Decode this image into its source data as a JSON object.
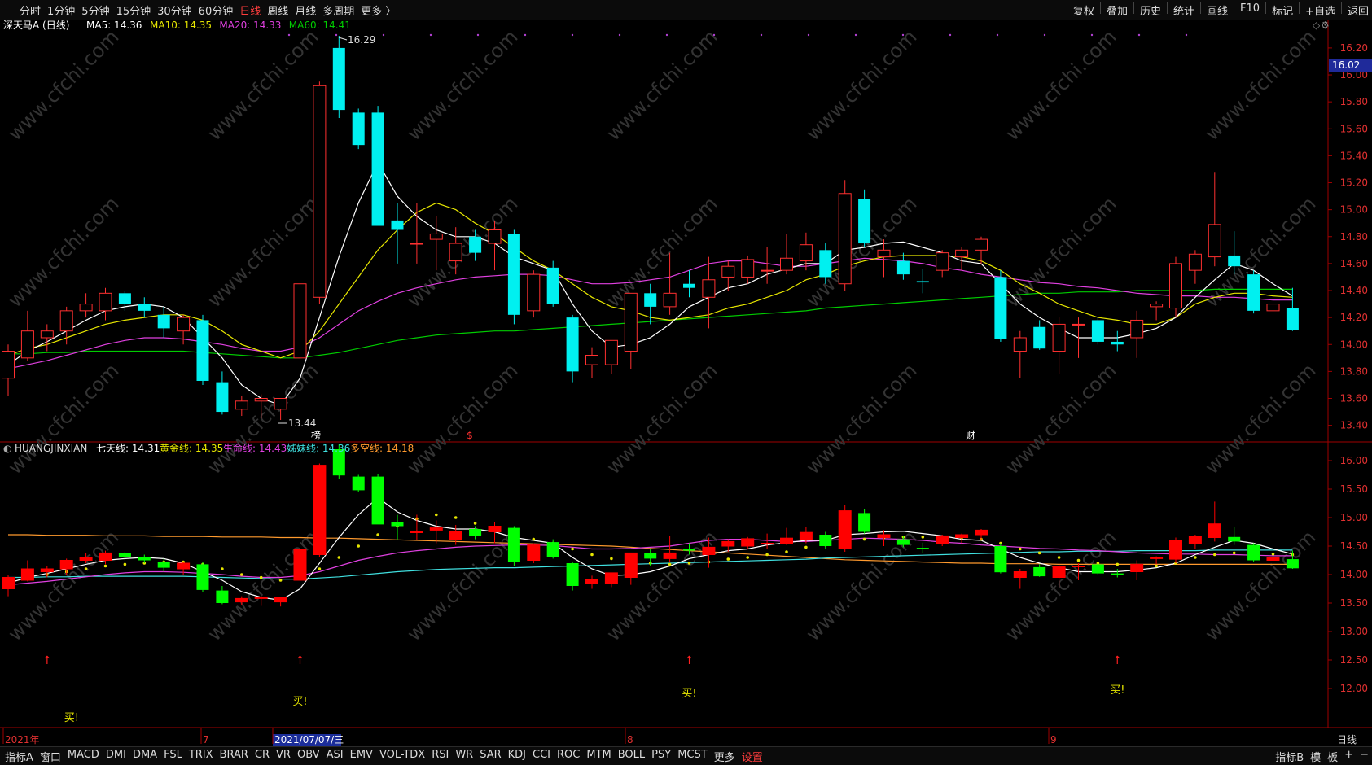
{
  "toolbar": {
    "periods": [
      "分时",
      "1分钟",
      "5分钟",
      "15分钟",
      "30分钟",
      "60分钟",
      "日线",
      "周线",
      "月线",
      "多周期",
      "更多 〉"
    ],
    "active_period": "日线",
    "right": [
      "复权",
      "叠加",
      "历史",
      "统计",
      "画线",
      "F10",
      "标记",
      "+自选",
      "返回"
    ]
  },
  "main_chart": {
    "stock_title": "深天马A (日线)",
    "legend": [
      {
        "label": "MA5: 14.36",
        "color": "#ffffff"
      },
      {
        "label": "MA10: 14.35",
        "color": "#e6e600"
      },
      {
        "label": "MA20: 14.33",
        "color": "#e040e0"
      },
      {
        "label": "MA60: 14.41",
        "color": "#00cc00"
      }
    ],
    "high_label": "16.29",
    "low_label": "13.44",
    "current_price_tag": "16.02",
    "y_axis_ticks": [
      "16.20",
      "16.00",
      "15.80",
      "15.60",
      "15.40",
      "15.20",
      "15.00",
      "14.80",
      "14.60",
      "14.40",
      "14.20",
      "14.00",
      "13.80",
      "13.60",
      "13.40"
    ],
    "markers": [
      {
        "text": "榜",
        "color": "#ffffff"
      },
      {
        "text": "$",
        "color": "#ff3030"
      },
      {
        "text": "财",
        "color": "#ffffff"
      }
    ]
  },
  "sub_chart": {
    "indicator_name": "HUANGJINXIAN",
    "legend": [
      {
        "label": "七天线: 14.31",
        "color": "#ffffff"
      },
      {
        "label": "黄金线: 14.35",
        "color": "#e6e600"
      },
      {
        "label": "生命线: 14.43",
        "color": "#e040e0"
      },
      {
        "label": "姊妹线: 14.36",
        "color": "#40e0e0"
      },
      {
        "label": "多空线: 14.18",
        "color": "#ff9a2e"
      }
    ],
    "y_axis_ticks": [
      "16.00",
      "15.50",
      "15.00",
      "14.50",
      "14.00",
      "13.50",
      "13.00",
      "12.50",
      "12.00"
    ],
    "buy_labels": [
      "买!",
      "买!",
      "买!",
      "买!"
    ]
  },
  "x_axis": {
    "labels": [
      "2021年",
      "7",
      "2021/07/07/三",
      "8",
      "9"
    ],
    "side_label": "日线"
  },
  "watermark": "www.cfchi.com",
  "bottom_tabs": [
    "指标A",
    "窗口",
    "MACD",
    "DMI",
    "DMA",
    "FSL",
    "TRIX",
    "BRAR",
    "CR",
    "VR",
    "OBV",
    "ASI",
    "EMV",
    "VOL-TDX",
    "RSI",
    "WR",
    "SAR",
    "KDJ",
    "CCI",
    "ROC",
    "MTM",
    "BOLL",
    "PSY",
    "MCST",
    "更多",
    "设置"
  ],
  "bottom_right": [
    "指标B",
    "模",
    "板",
    "+",
    "−"
  ],
  "colors": {
    "up": "#ff3030",
    "down": "#00f0f0",
    "sub_up": "#ff0000",
    "sub_down": "#00ff00",
    "grid": "#5a0000"
  },
  "chart_data": {
    "type": "candlestick",
    "candles": [
      {
        "o": 13.75,
        "h": 14.0,
        "l": 13.62,
        "c": 13.95
      },
      {
        "o": 13.9,
        "h": 14.25,
        "l": 13.88,
        "c": 14.1
      },
      {
        "o": 14.05,
        "h": 14.15,
        "l": 13.95,
        "c": 14.1
      },
      {
        "o": 14.1,
        "h": 14.28,
        "l": 14.0,
        "c": 14.25
      },
      {
        "o": 14.25,
        "h": 14.38,
        "l": 14.2,
        "c": 14.3
      },
      {
        "o": 14.25,
        "h": 14.42,
        "l": 14.18,
        "c": 14.38
      },
      {
        "o": 14.38,
        "h": 14.4,
        "l": 14.25,
        "c": 14.3
      },
      {
        "o": 14.3,
        "h": 14.35,
        "l": 14.2,
        "c": 14.25
      },
      {
        "o": 14.22,
        "h": 14.28,
        "l": 14.05,
        "c": 14.12
      },
      {
        "o": 14.1,
        "h": 14.22,
        "l": 14.0,
        "c": 14.2
      },
      {
        "o": 14.18,
        "h": 14.22,
        "l": 13.7,
        "c": 13.73
      },
      {
        "o": 13.72,
        "h": 13.8,
        "l": 13.48,
        "c": 13.5
      },
      {
        "o": 13.52,
        "h": 13.62,
        "l": 13.47,
        "c": 13.58
      },
      {
        "o": 13.58,
        "h": 13.63,
        "l": 13.45,
        "c": 13.6
      },
      {
        "o": 13.52,
        "h": 13.58,
        "l": 13.44,
        "c": 13.6
      },
      {
        "o": 13.9,
        "h": 14.78,
        "l": 13.85,
        "c": 14.45
      },
      {
        "o": 14.35,
        "h": 15.95,
        "l": 14.3,
        "c": 15.92
      },
      {
        "o": 16.2,
        "h": 16.29,
        "l": 15.68,
        "c": 15.74
      },
      {
        "o": 15.72,
        "h": 15.75,
        "l": 15.45,
        "c": 15.48
      },
      {
        "o": 15.72,
        "h": 15.77,
        "l": 14.98,
        "c": 14.88
      },
      {
        "o": 14.92,
        "h": 15.05,
        "l": 14.6,
        "c": 14.85
      },
      {
        "o": 14.75,
        "h": 15.05,
        "l": 14.6,
        "c": 14.75
      },
      {
        "o": 14.78,
        "h": 14.95,
        "l": 14.55,
        "c": 14.82
      },
      {
        "o": 14.62,
        "h": 14.87,
        "l": 14.52,
        "c": 14.75
      },
      {
        "o": 14.8,
        "h": 14.85,
        "l": 14.62,
        "c": 14.68
      },
      {
        "o": 14.75,
        "h": 14.92,
        "l": 14.55,
        "c": 14.85
      },
      {
        "o": 14.82,
        "h": 14.85,
        "l": 14.15,
        "c": 14.22
      },
      {
        "o": 14.25,
        "h": 14.55,
        "l": 14.2,
        "c": 14.52
      },
      {
        "o": 14.57,
        "h": 14.62,
        "l": 14.28,
        "c": 14.3
      },
      {
        "o": 14.2,
        "h": 14.22,
        "l": 13.72,
        "c": 13.8
      },
      {
        "o": 13.85,
        "h": 13.98,
        "l": 13.75,
        "c": 13.92
      },
      {
        "o": 13.85,
        "h": 14.02,
        "l": 13.78,
        "c": 14.03
      },
      {
        "o": 13.95,
        "h": 14.35,
        "l": 13.82,
        "c": 14.38
      },
      {
        "o": 14.38,
        "h": 14.45,
        "l": 14.15,
        "c": 14.28
      },
      {
        "o": 14.28,
        "h": 14.68,
        "l": 14.22,
        "c": 14.38
      },
      {
        "o": 14.45,
        "h": 14.55,
        "l": 14.35,
        "c": 14.42
      },
      {
        "o": 14.35,
        "h": 14.65,
        "l": 14.12,
        "c": 14.48
      },
      {
        "o": 14.5,
        "h": 14.62,
        "l": 14.4,
        "c": 14.58
      },
      {
        "o": 14.5,
        "h": 14.66,
        "l": 14.45,
        "c": 14.63
      },
      {
        "o": 14.55,
        "h": 14.72,
        "l": 14.45,
        "c": 14.55
      },
      {
        "o": 14.55,
        "h": 14.82,
        "l": 14.52,
        "c": 14.64
      },
      {
        "o": 14.62,
        "h": 14.83,
        "l": 14.55,
        "c": 14.74
      },
      {
        "o": 14.7,
        "h": 14.75,
        "l": 14.45,
        "c": 14.5
      },
      {
        "o": 14.45,
        "h": 15.22,
        "l": 14.4,
        "c": 15.12
      },
      {
        "o": 15.08,
        "h": 15.15,
        "l": 14.72,
        "c": 14.75
      },
      {
        "o": 14.65,
        "h": 14.78,
        "l": 14.5,
        "c": 14.7
      },
      {
        "o": 14.62,
        "h": 14.68,
        "l": 14.48,
        "c": 14.52
      },
      {
        "o": 14.47,
        "h": 14.56,
        "l": 14.38,
        "c": 14.46
      },
      {
        "o": 14.55,
        "h": 14.7,
        "l": 14.5,
        "c": 14.68
      },
      {
        "o": 14.65,
        "h": 14.72,
        "l": 14.55,
        "c": 14.7
      },
      {
        "o": 14.7,
        "h": 14.8,
        "l": 14.6,
        "c": 14.78
      },
      {
        "o": 14.5,
        "h": 14.55,
        "l": 14.02,
        "c": 14.04
      },
      {
        "o": 13.95,
        "h": 14.1,
        "l": 13.75,
        "c": 14.05
      },
      {
        "o": 14.13,
        "h": 14.18,
        "l": 13.96,
        "c": 13.97
      },
      {
        "o": 13.95,
        "h": 14.2,
        "l": 13.78,
        "c": 14.15
      },
      {
        "o": 14.15,
        "h": 14.2,
        "l": 13.9,
        "c": 14.15
      },
      {
        "o": 14.18,
        "h": 14.2,
        "l": 14.0,
        "c": 14.02
      },
      {
        "o": 14.02,
        "h": 14.1,
        "l": 13.95,
        "c": 14.0
      },
      {
        "o": 14.05,
        "h": 14.25,
        "l": 13.9,
        "c": 14.18
      },
      {
        "o": 14.28,
        "h": 14.32,
        "l": 14.18,
        "c": 14.3
      },
      {
        "o": 14.27,
        "h": 14.65,
        "l": 14.2,
        "c": 14.6
      },
      {
        "o": 14.55,
        "h": 14.7,
        "l": 14.45,
        "c": 14.67
      },
      {
        "o": 14.65,
        "h": 15.28,
        "l": 14.58,
        "c": 14.89
      },
      {
        "o": 14.66,
        "h": 14.84,
        "l": 14.52,
        "c": 14.58
      },
      {
        "o": 14.52,
        "h": 14.55,
        "l": 14.23,
        "c": 14.25
      },
      {
        "o": 14.25,
        "h": 14.35,
        "l": 14.2,
        "c": 14.3
      },
      {
        "o": 14.27,
        "h": 14.42,
        "l": 14.1,
        "c": 14.11
      }
    ],
    "ma5": [
      13.85,
      13.95,
      14.02,
      14.1,
      14.18,
      14.25,
      14.28,
      14.3,
      14.28,
      14.2,
      14.05,
      13.9,
      13.7,
      13.6,
      13.55,
      13.75,
      14.2,
      14.65,
      15.05,
      15.35,
      15.1,
      14.95,
      14.85,
      14.8,
      14.8,
      14.75,
      14.65,
      14.6,
      14.55,
      14.3,
      14.1,
      13.98,
      14.0,
      14.05,
      14.15,
      14.28,
      14.35,
      14.42,
      14.45,
      14.52,
      14.56,
      14.6,
      14.6,
      14.7,
      14.72,
      14.75,
      14.76,
      14.72,
      14.68,
      14.62,
      14.6,
      14.45,
      14.3,
      14.2,
      14.12,
      14.05,
      14.05,
      14.05,
      14.08,
      14.12,
      14.2,
      14.35,
      14.48,
      14.6,
      14.55,
      14.45,
      14.36
    ],
    "ma10": [
      13.92,
      13.97,
      14.0,
      14.05,
      14.1,
      14.15,
      14.18,
      14.2,
      14.22,
      14.22,
      14.18,
      14.1,
      14.0,
      13.95,
      13.9,
      13.95,
      14.1,
      14.3,
      14.5,
      14.7,
      14.85,
      14.98,
      15.05,
      15.0,
      14.9,
      14.82,
      14.72,
      14.62,
      14.55,
      14.45,
      14.35,
      14.28,
      14.25,
      14.2,
      14.18,
      14.2,
      14.22,
      14.27,
      14.3,
      14.35,
      14.4,
      14.48,
      14.52,
      14.58,
      14.62,
      14.65,
      14.66,
      14.66,
      14.66,
      14.65,
      14.62,
      14.55,
      14.45,
      14.38,
      14.3,
      14.25,
      14.2,
      14.18,
      14.15,
      14.15,
      14.2,
      14.3,
      14.35,
      14.38,
      14.38,
      14.36,
      14.35
    ],
    "ma20": [
      13.82,
      13.85,
      13.88,
      13.92,
      13.96,
      14.0,
      14.03,
      14.05,
      14.05,
      14.04,
      14.02,
      14.0,
      13.97,
      13.95,
      13.95,
      13.98,
      14.05,
      14.15,
      14.25,
      14.32,
      14.38,
      14.42,
      14.45,
      14.48,
      14.5,
      14.51,
      14.52,
      14.52,
      14.51,
      14.48,
      14.45,
      14.45,
      14.46,
      14.48,
      14.5,
      14.55,
      14.6,
      14.62,
      14.62,
      14.6,
      14.58,
      14.58,
      14.6,
      14.62,
      14.64,
      14.63,
      14.62,
      14.6,
      14.57,
      14.55,
      14.52,
      14.5,
      14.48,
      14.46,
      14.45,
      14.43,
      14.42,
      14.4,
      14.38,
      14.37,
      14.36,
      14.36,
      14.35,
      14.35,
      14.34,
      14.33,
      14.33
    ],
    "ma60": [
      13.93,
      13.93,
      13.94,
      13.94,
      13.95,
      13.95,
      13.95,
      13.95,
      13.95,
      13.95,
      13.94,
      13.93,
      13.92,
      13.91,
      13.9,
      13.9,
      13.92,
      13.94,
      13.97,
      14.0,
      14.03,
      14.05,
      14.07,
      14.08,
      14.09,
      14.1,
      14.1,
      14.11,
      14.12,
      14.13,
      14.14,
      14.15,
      14.16,
      14.17,
      14.18,
      14.19,
      14.2,
      14.21,
      14.22,
      14.23,
      14.24,
      14.25,
      14.27,
      14.28,
      14.29,
      14.3,
      14.31,
      14.32,
      14.33,
      14.34,
      14.35,
      14.36,
      14.37,
      14.38,
      14.38,
      14.39,
      14.39,
      14.39,
      14.4,
      14.4,
      14.4,
      14.4,
      14.41,
      14.41,
      14.41,
      14.41,
      14.41
    ],
    "duokong_line": [
      14.7,
      14.7,
      14.69,
      14.69,
      14.69,
      14.68,
      14.68,
      14.68,
      14.67,
      14.67,
      14.67,
      14.66,
      14.66,
      14.66,
      14.65,
      14.65,
      14.64,
      14.64,
      14.63,
      14.62,
      14.61,
      14.6,
      14.59,
      14.58,
      14.57,
      14.56,
      14.55,
      14.54,
      14.53,
      14.52,
      14.51,
      14.5,
      14.48,
      14.46,
      14.44,
      14.42,
      14.4,
      14.38,
      14.36,
      14.34,
      14.32,
      14.3,
      14.28,
      14.26,
      14.25,
      14.24,
      14.23,
      14.22,
      14.21,
      14.2,
      14.2,
      14.19,
      14.19,
      14.19,
      14.18,
      14.18,
      14.18,
      14.18,
      14.18,
      14.18,
      14.18,
      14.18,
      14.18,
      14.18,
      14.18,
      14.18,
      14.18
    ],
    "buy_signal_indices": [
      1,
      15,
      35,
      57
    ],
    "dividend_marker_index": [
      15,
      23,
      51
    ]
  }
}
